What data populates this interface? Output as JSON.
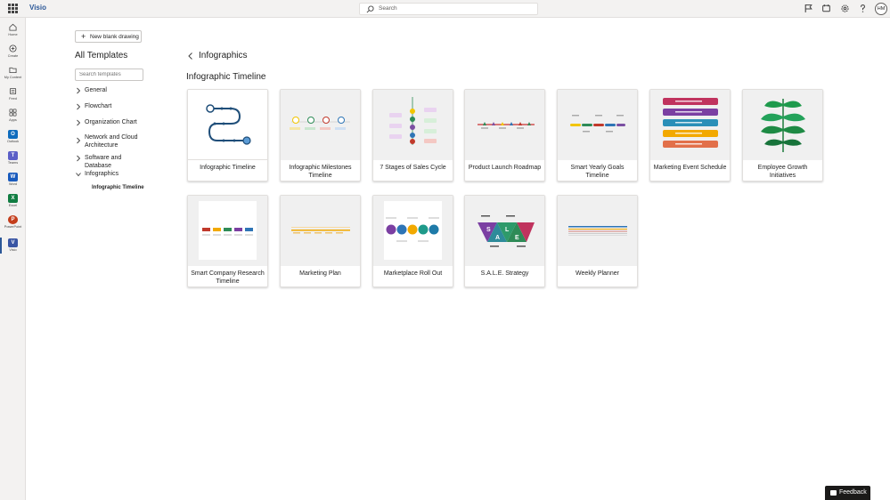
{
  "app": {
    "name": "Visio",
    "brand_color": "#2b5797"
  },
  "search": {
    "placeholder": "Search"
  },
  "user": {
    "initials": "HM"
  },
  "rail": {
    "items": [
      {
        "label": "Home",
        "icon": "home-icon"
      },
      {
        "label": "Create",
        "icon": "create-icon"
      },
      {
        "label": "My Content",
        "icon": "folder-icon"
      },
      {
        "label": "Feed",
        "icon": "feed-icon"
      },
      {
        "label": "Apps",
        "icon": "apps-icon"
      },
      {
        "label": "Outlook",
        "icon": "outlook-icon",
        "color": "#0f6cbd"
      },
      {
        "label": "Teams",
        "icon": "teams-icon",
        "color": "#5b5fc7"
      },
      {
        "label": "Word",
        "icon": "word-icon",
        "color": "#185abd"
      },
      {
        "label": "Excel",
        "icon": "excel-icon",
        "color": "#107c41"
      },
      {
        "label": "PowerPoint",
        "icon": "powerpoint-icon",
        "color": "#c43e1c"
      },
      {
        "label": "Visio",
        "icon": "visio-icon",
        "color": "#3955a3"
      }
    ]
  },
  "panel": {
    "new_label": "New blank drawing",
    "title": "All Templates",
    "search_placeholder": "Search templates",
    "categories": [
      {
        "label": "General"
      },
      {
        "label": "Flowchart"
      },
      {
        "label": "Organization Chart"
      },
      {
        "label": "Network and Cloud Architecture"
      },
      {
        "label": "Software and Database"
      },
      {
        "label": "Infographics"
      }
    ],
    "sub_item": "Infographic Timeline"
  },
  "main": {
    "section": "Infographics",
    "group": "Infographic Timeline",
    "cards": [
      {
        "title": "Infographic Timeline"
      },
      {
        "title": "Infographic Milestones Timeline"
      },
      {
        "title": "7 Stages of Sales Cycle"
      },
      {
        "title": "Product Launch Roadmap"
      },
      {
        "title": "Smart Yearly Goals Timeline"
      },
      {
        "title": "Marketing Event Schedule"
      },
      {
        "title": "Employee Growth Initiatives"
      },
      {
        "title": "Smart Company Research Timeline"
      },
      {
        "title": "Marketing Plan"
      },
      {
        "title": "Marketplace Roll Out"
      },
      {
        "title": "S.A.L.E. Strategy"
      },
      {
        "title": "Weekly Planner"
      }
    ]
  },
  "thumb_text": {
    "sale_s": "S",
    "sale_a": "A",
    "sale_l": "L",
    "sale_e": "E"
  },
  "feedback": {
    "label": "Feedback"
  }
}
